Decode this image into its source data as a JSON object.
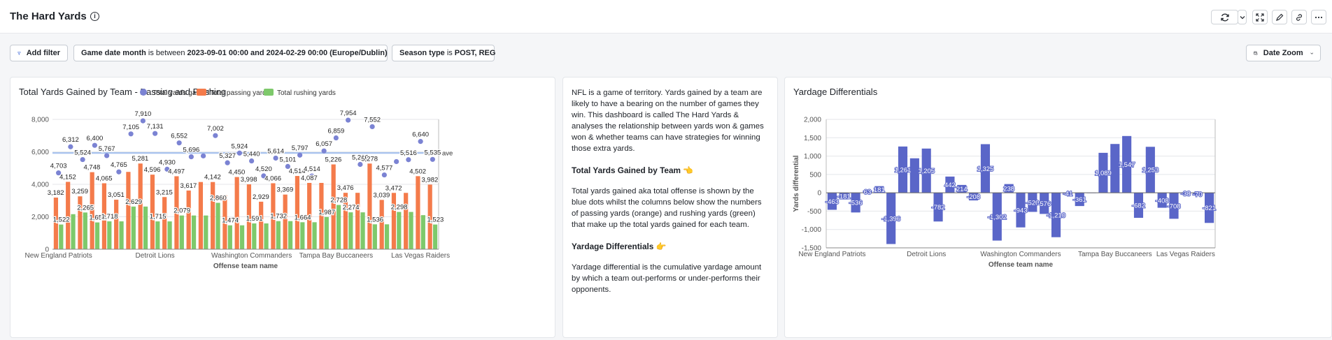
{
  "header": {
    "title": "The Hard Yards"
  },
  "filters": {
    "add_filter_label": "Add filter",
    "date_filter": {
      "field": "Game date month",
      "op": "is between",
      "value": "2023-09-01 00:00 and 2024-02-29 00:00 (Europe/Dublin)"
    },
    "season_filter": {
      "field": "Season type",
      "op": "is",
      "value": "POST, REG"
    },
    "date_zoom_label": "Date Zoom"
  },
  "left_panel": {
    "title": "Total Yards Gained by Team - Passing and Rushing"
  },
  "text_panel": {
    "intro": "NFL is a game of territory. Yards gained by a team are likely to have a bearing on the number of games they win. This dashboard is called The Hard Yards & analyses the relationship between yards won & games won & whether teams can have strategies for winning those extra yards.",
    "heading1": "Total Yards Gained by Team 👈",
    "para1": "Total yards gained aka total offense is shown by the blue dots whilst the columns below show the numbers of passing yards (orange) and rushing yards (green) that make up the total yards gained for each team.",
    "heading2": "Yardage Differentials 👉",
    "para2": "Yardage differential is the cumulative yardage amount by which a team out-performs or under-performs their opponents."
  },
  "right_panel": {
    "title": "Yardage Differentials"
  },
  "colors": {
    "total": "#7b83d3",
    "passing": "#f47b4b",
    "rushing": "#7ec96b",
    "bars": "#5a66c8",
    "avg_line": "#a9c4ef"
  },
  "chart_data": [
    {
      "type": "bar",
      "title": "Total Yards Gained by Team - Passing and Rushing",
      "xlabel": "Offense team name",
      "ylabel": "",
      "ylim": [
        0,
        8000
      ],
      "yticks": [
        "0",
        "2,000",
        "4,000",
        "6,000",
        "8,000"
      ],
      "x_tick_labels": [
        "New England Patriots",
        "Detroit Lions",
        "Washington Commanders",
        "Tampa Bay Buccaneers",
        "Las Vegas Raiders"
      ],
      "average_label": "ave",
      "average_value": 5930,
      "series": [
        {
          "name": "Total yards gained",
          "kind": "scatter",
          "values": [
            4703,
            6312,
            5524,
            6400,
            5767,
            4765,
            7105,
            7910,
            7131,
            4930,
            6552,
            5696,
            5750,
            7002,
            5327,
            5924,
            5440,
            4520,
            5614,
            5101,
            5797,
            4514,
            6057,
            6859,
            7954,
            5226,
            7552,
            4577,
            5400,
            5516,
            6640,
            5535
          ],
          "labels": [
            "4,703",
            "6,312",
            "5,524",
            "6,400",
            "5,767",
            "4,765",
            "7,105",
            "7,910",
            "7,131",
            "4,930",
            "6,552",
            "5,696",
            "",
            "7,002",
            "5,327",
            "5,924",
            "5,440",
            "4,520",
            "5,614",
            "5,101",
            "5,797",
            "4,514",
            "6,057",
            "6,859",
            "7,954",
            "5,226",
            "7,552",
            "4,577",
            "",
            "5,516",
            "6,640",
            "5,535"
          ]
        },
        {
          "name": "Total passing yards",
          "kind": "bar",
          "values": [
            3182,
            4152,
            3259,
            4748,
            4065,
            3051,
            4765,
            5281,
            4596,
            3215,
            4497,
            3617,
            4142,
            4142,
            3327,
            4450,
            3998,
            2929,
            4066,
            3369,
            4514,
            4087,
            4087,
            5226,
            3476,
            3476,
            5278,
            3039,
            3472,
            3472,
            4502,
            3982
          ],
          "labels": [
            "3,182",
            "4,152",
            "3,259",
            "4,748",
            "4,065",
            "3,051",
            "",
            "5,281",
            "4,596",
            "3,215",
            "4,497",
            "3,617",
            "",
            "4,142",
            "",
            "4,450",
            "3,998",
            "2,929",
            "4,066",
            "3,369",
            "4,514",
            "4,087",
            "",
            "5,226",
            "3,476",
            "",
            "5,278",
            "3,039",
            "3,472",
            "",
            "4,502",
            "3,982"
          ]
        },
        {
          "name": "Total rushing yards",
          "kind": "bar",
          "values": [
            1522,
            2160,
            2265,
            1652,
            1718,
            1718,
            2629,
            2629,
            1715,
            1715,
            2079,
            2079,
            2079,
            2860,
            1474,
            1474,
            1591,
            1591,
            1732,
            1732,
            1664,
            1664,
            1987,
            2728,
            2274,
            2274,
            1536,
            1536,
            2298,
            2298,
            2100,
            1523
          ],
          "labels": [
            "1,522",
            "",
            "2,265",
            "1,652",
            "1,718",
            "",
            "2,629",
            "",
            "1,715",
            "",
            "2,079",
            "",
            "",
            "2,860",
            "1,474",
            "",
            "1,591",
            "",
            "1,732",
            "",
            "1,664",
            "",
            "1,987",
            "2,728",
            "2,274",
            "",
            "1,536",
            "",
            "2,298",
            "",
            "",
            "1,523"
          ]
        }
      ]
    },
    {
      "type": "bar",
      "title": "Yardage Differentials",
      "xlabel": "Offense team name",
      "ylabel": "Yards differential",
      "ylim": [
        -1500,
        2000
      ],
      "yticks": [
        "-1,500",
        "-1,000",
        "-500",
        "0",
        "500",
        "1,000",
        "1,500",
        "2,000"
      ],
      "x_tick_labels": [
        "New England Patriots",
        "Detroit Lions",
        "Washington Commanders",
        "Tampa Bay Buccaneers",
        "Las Vegas Raiders"
      ],
      "series": [
        {
          "name": "Yards differential",
          "values": [
            -463,
            -181,
            -536,
            63,
            181,
            -1396,
            1261,
            940,
            1205,
            -782,
            442,
            214,
            -208,
            1325,
            -1302,
            238,
            -943,
            -520,
            -576,
            -1210,
            -41,
            -361,
            0,
            1089,
            1330,
            1547,
            -682,
            1253,
            -408,
            -708,
            -38,
            -70,
            -821
          ],
          "labels": [
            "-463",
            "-181",
            "-536",
            "63",
            "181",
            "-1,396",
            "1,261",
            "",
            "1,205",
            "-782",
            "442",
            "214",
            "-208",
            "1,325",
            "-1,302",
            "238",
            "-943",
            "-520",
            "-576",
            "-1,210",
            "-41",
            "-361",
            "",
            "1,089",
            "",
            "1,547",
            "-682",
            "1,253",
            "-408",
            "-708",
            "-38",
            "-70",
            "-821"
          ]
        }
      ]
    }
  ]
}
